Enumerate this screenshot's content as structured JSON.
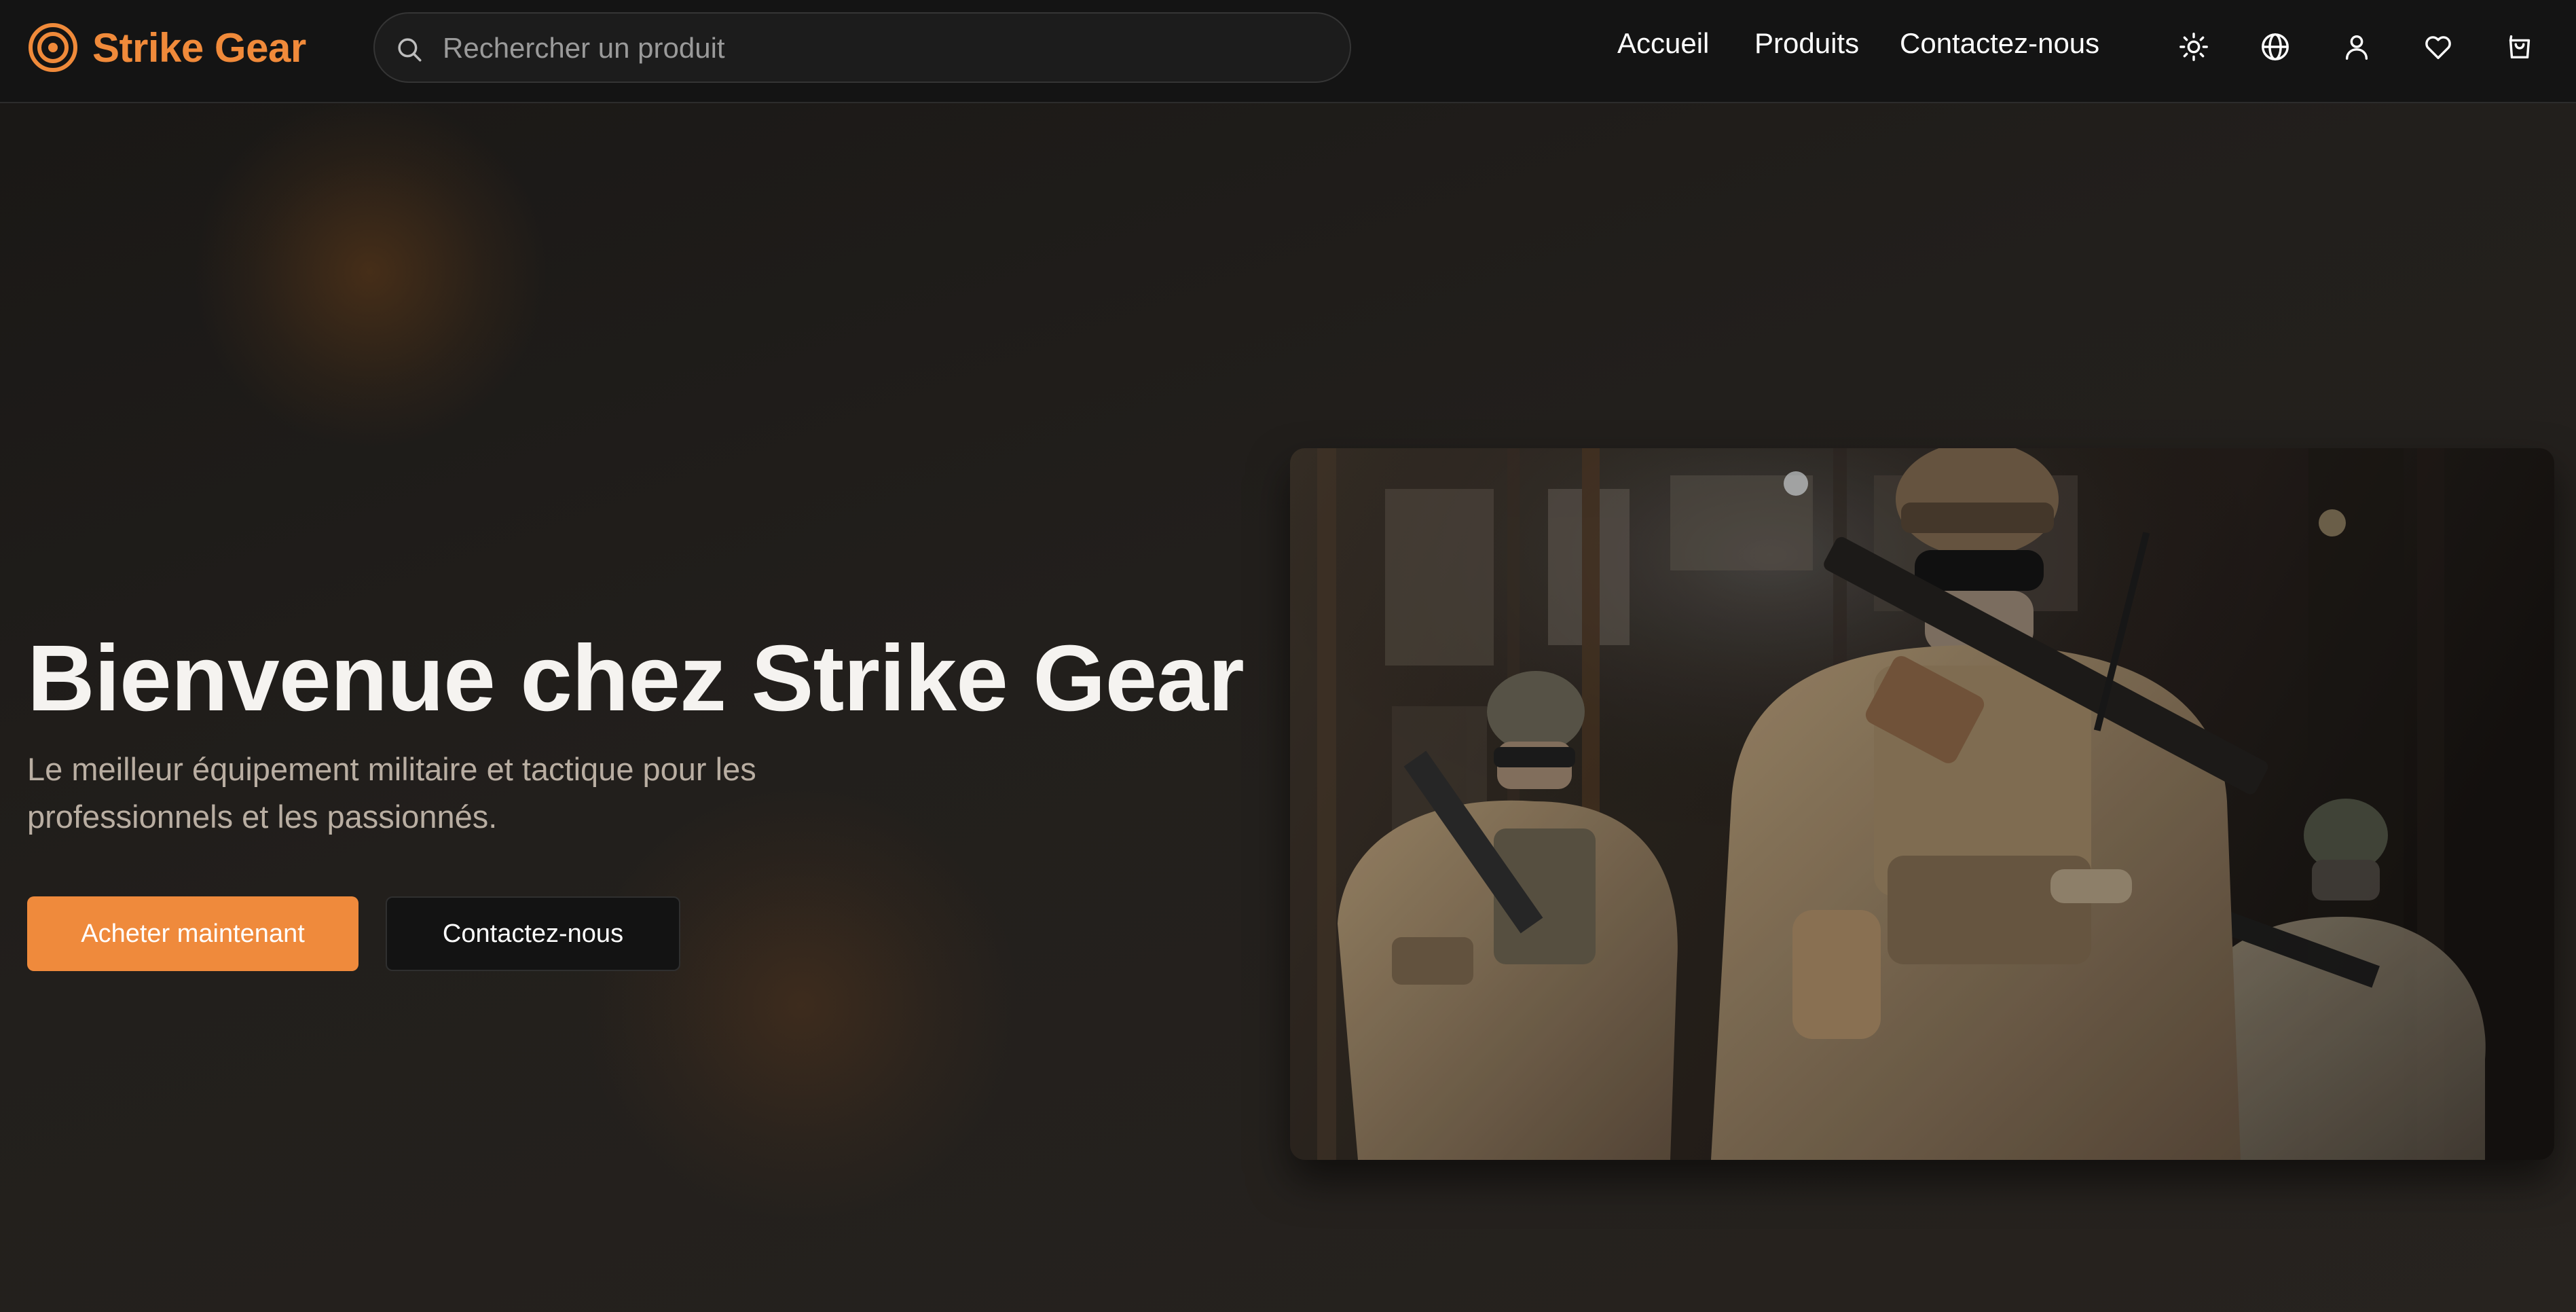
{
  "brand": {
    "name": "Strike Gear",
    "accent_color": "#f08a3a"
  },
  "header": {
    "search_placeholder": "Rechercher un produit",
    "nav": [
      "Accueil",
      "Produits",
      "Contactez-nous"
    ],
    "icons": [
      "theme-toggle-icon",
      "language-globe-icon",
      "account-user-icon",
      "wishlist-heart-icon",
      "cart-bag-icon"
    ]
  },
  "hero": {
    "title": "Bienvenue chez Strike Gear",
    "subtitle": "Le meilleur équipement militaire et tactique pour les professionnels et les passionnés.",
    "primary_button": "Acheter maintenant",
    "secondary_button": "Contactez-nous",
    "image_subject": "soldiers-photo"
  }
}
